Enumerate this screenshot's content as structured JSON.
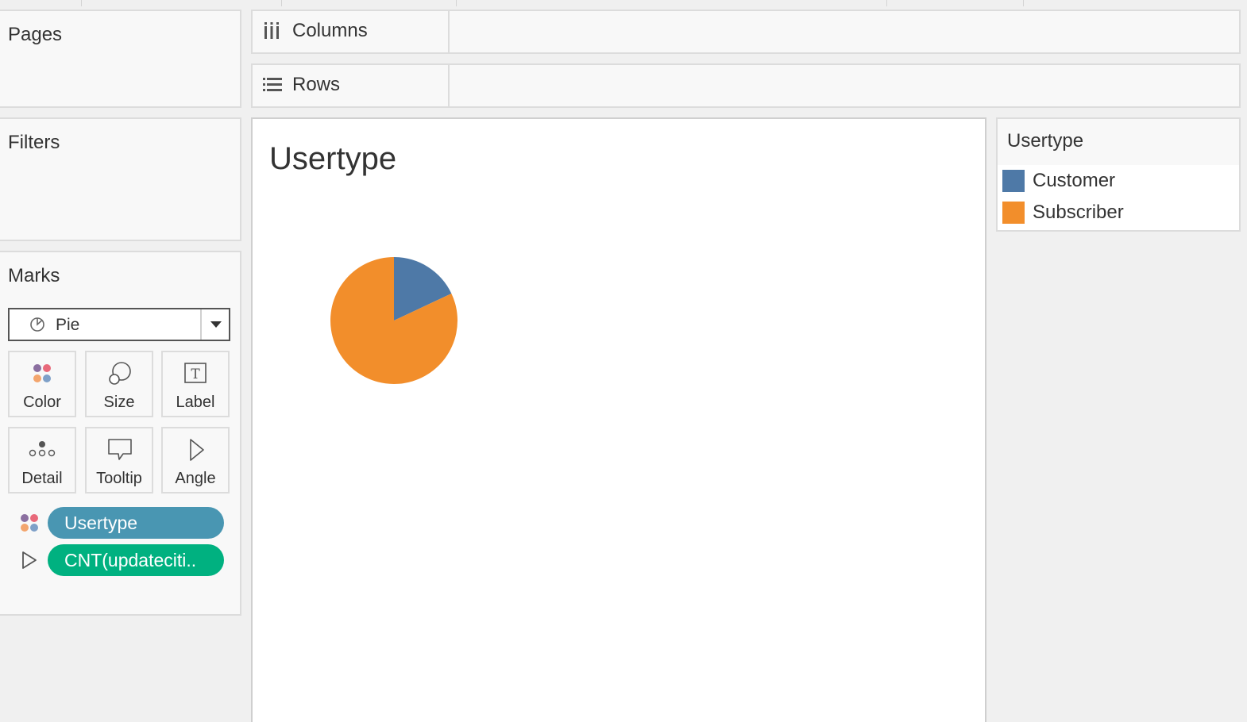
{
  "shelves": {
    "pages_title": "Pages",
    "filters_title": "Filters",
    "marks_title": "Marks",
    "columns_label": "Columns",
    "rows_label": "Rows"
  },
  "marks": {
    "mark_type": "Pie",
    "buttons": [
      {
        "label": "Color",
        "icon": "color-dots-icon"
      },
      {
        "label": "Size",
        "icon": "size-icon"
      },
      {
        "label": "Label",
        "icon": "label-text-icon"
      },
      {
        "label": "Detail",
        "icon": "detail-dots-icon"
      },
      {
        "label": "Tooltip",
        "icon": "tooltip-icon"
      },
      {
        "label": "Angle",
        "icon": "angle-icon"
      }
    ],
    "pills": [
      {
        "text": "Usertype",
        "color": "#4996b2",
        "icon": "color-dots-icon"
      },
      {
        "text": "CNT(updateciti..",
        "color": "#00b180",
        "icon": "angle-icon"
      }
    ]
  },
  "view": {
    "title": "Usertype"
  },
  "legend": {
    "title": "Usertype",
    "items": [
      {
        "label": "Customer",
        "color": "#4e79a7"
      },
      {
        "label": "Subscriber",
        "color": "#f28e2b"
      }
    ]
  },
  "chart_data": {
    "type": "pie",
    "title": "Usertype",
    "categories": [
      "Customer",
      "Subscriber"
    ],
    "values": [
      18,
      82
    ],
    "colors": [
      "#4e79a7",
      "#f28e2b"
    ]
  }
}
